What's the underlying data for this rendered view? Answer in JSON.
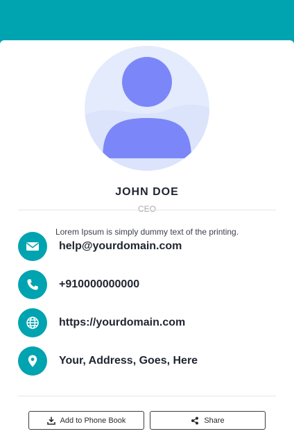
{
  "profile": {
    "name": "JOHN DOE",
    "role": "CEO",
    "bio": "Lorem Ipsum is simply dummy text of the printing."
  },
  "contacts": [
    {
      "icon": "envelope-icon",
      "text": "help@yourdomain.com"
    },
    {
      "icon": "phone-icon",
      "text": "+910000000000"
    },
    {
      "icon": "globe-icon",
      "text": "https://yourdomain.com"
    },
    {
      "icon": "map-pin-icon",
      "text": "Your, Address, Goes, Here"
    }
  ],
  "actions": {
    "add_label": "Add to Phone Book",
    "share_label": "Share"
  },
  "colors": {
    "accent": "#00a3b0",
    "avatar_bg": "#e3ebfc",
    "avatar_figure": "#7b87f8",
    "text_dark": "#1f2430",
    "text_muted": "#a8a8a8"
  }
}
